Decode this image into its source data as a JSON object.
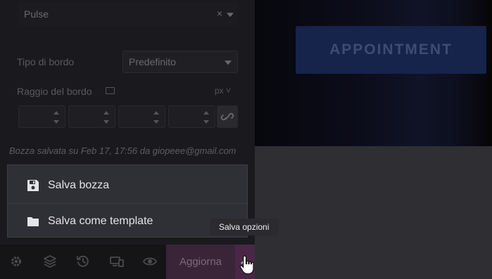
{
  "editor": {
    "animation_select": {
      "value": "Pulse"
    },
    "border_type": {
      "label": "Tipo di bordo",
      "value": "Predefinito"
    },
    "border_radius": {
      "label": "Raggio del bordo",
      "unit": "px"
    },
    "draft_note": "Bozza salvata su Feb 17, 17:56 da giopeee@gmail.com"
  },
  "save_menu": {
    "items": [
      {
        "label": "Salva bozza",
        "icon": "floppy-disk-icon"
      },
      {
        "label": "Salva come template",
        "icon": "folder-icon"
      }
    ]
  },
  "preview": {
    "button_label": "APPOINTMENT"
  },
  "toolbar": {
    "icons": [
      "gear-icon",
      "layers-icon",
      "history-icon",
      "responsive-icon",
      "eye-icon"
    ],
    "update_label": "Aggiorna",
    "options_tooltip": "Salva opzioni"
  },
  "colors": {
    "panel_bg": "#1a1a1e",
    "menu_bg": "#2f2f36",
    "update_bg": "#3a2438",
    "appointment_bg": "#16234a"
  }
}
